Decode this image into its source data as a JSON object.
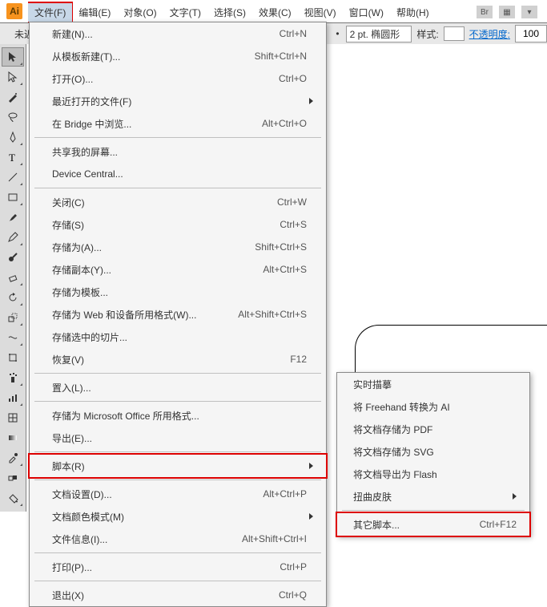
{
  "app": {
    "logo": "Ai",
    "unsaved": "未迟"
  },
  "menubar": {
    "items": [
      {
        "label": "文件(F)"
      },
      {
        "label": "编辑(E)"
      },
      {
        "label": "对象(O)"
      },
      {
        "label": "文字(T)"
      },
      {
        "label": "选择(S)"
      },
      {
        "label": "效果(C)"
      },
      {
        "label": "视图(V)"
      },
      {
        "label": "窗口(W)"
      },
      {
        "label": "帮助(H)"
      }
    ],
    "br": "Br",
    "grid": "▦",
    "dd": "▾"
  },
  "options": {
    "stroke": "2 pt. 椭圆形",
    "style_label": "样式:",
    "opacity_label": "不透明度:",
    "opacity": "100"
  },
  "file_menu": {
    "items": [
      {
        "label": "新建(N)...",
        "sc": "Ctrl+N"
      },
      {
        "label": "从模板新建(T)...",
        "sc": "Shift+Ctrl+N"
      },
      {
        "label": "打开(O)...",
        "sc": "Ctrl+O"
      },
      {
        "label": "最近打开的文件(F)",
        "sub": true
      },
      {
        "label": "在 Bridge 中浏览...",
        "sc": "Alt+Ctrl+O"
      },
      {
        "sep": true
      },
      {
        "label": "共享我的屏幕..."
      },
      {
        "label": "Device Central..."
      },
      {
        "sep": true
      },
      {
        "label": "关闭(C)",
        "sc": "Ctrl+W"
      },
      {
        "label": "存储(S)",
        "sc": "Ctrl+S"
      },
      {
        "label": "存储为(A)...",
        "sc": "Shift+Ctrl+S"
      },
      {
        "label": "存储副本(Y)...",
        "sc": "Alt+Ctrl+S"
      },
      {
        "label": "存储为模板..."
      },
      {
        "label": "存储为 Web 和设备所用格式(W)...",
        "sc": "Alt+Shift+Ctrl+S"
      },
      {
        "label": "存储选中的切片..."
      },
      {
        "label": "恢复(V)",
        "sc": "F12"
      },
      {
        "sep": true
      },
      {
        "label": "置入(L)..."
      },
      {
        "sep": true
      },
      {
        "label": "存储为 Microsoft Office 所用格式..."
      },
      {
        "label": "导出(E)..."
      },
      {
        "sep": true
      },
      {
        "label": "脚本(R)",
        "sub": true,
        "hi": true
      },
      {
        "sep": true
      },
      {
        "label": "文档设置(D)...",
        "sc": "Alt+Ctrl+P"
      },
      {
        "label": "文档颜色模式(M)",
        "sub": true
      },
      {
        "label": "文件信息(I)...",
        "sc": "Alt+Shift+Ctrl+I"
      },
      {
        "sep": true
      },
      {
        "label": "打印(P)...",
        "sc": "Ctrl+P"
      },
      {
        "sep": true
      },
      {
        "label": "退出(X)",
        "sc": "Ctrl+Q"
      }
    ]
  },
  "script_submenu": {
    "items": [
      {
        "label": "实时描摹"
      },
      {
        "label": "将 Freehand 转换为 AI"
      },
      {
        "label": "将文档存储为 PDF"
      },
      {
        "label": "将文档存储为 SVG"
      },
      {
        "label": "将文档导出为 Flash"
      },
      {
        "label": "扭曲皮肤",
        "sub": true
      },
      {
        "sep": true
      },
      {
        "label": "其它脚本...",
        "sc": "Ctrl+F12",
        "hi": true
      }
    ]
  }
}
